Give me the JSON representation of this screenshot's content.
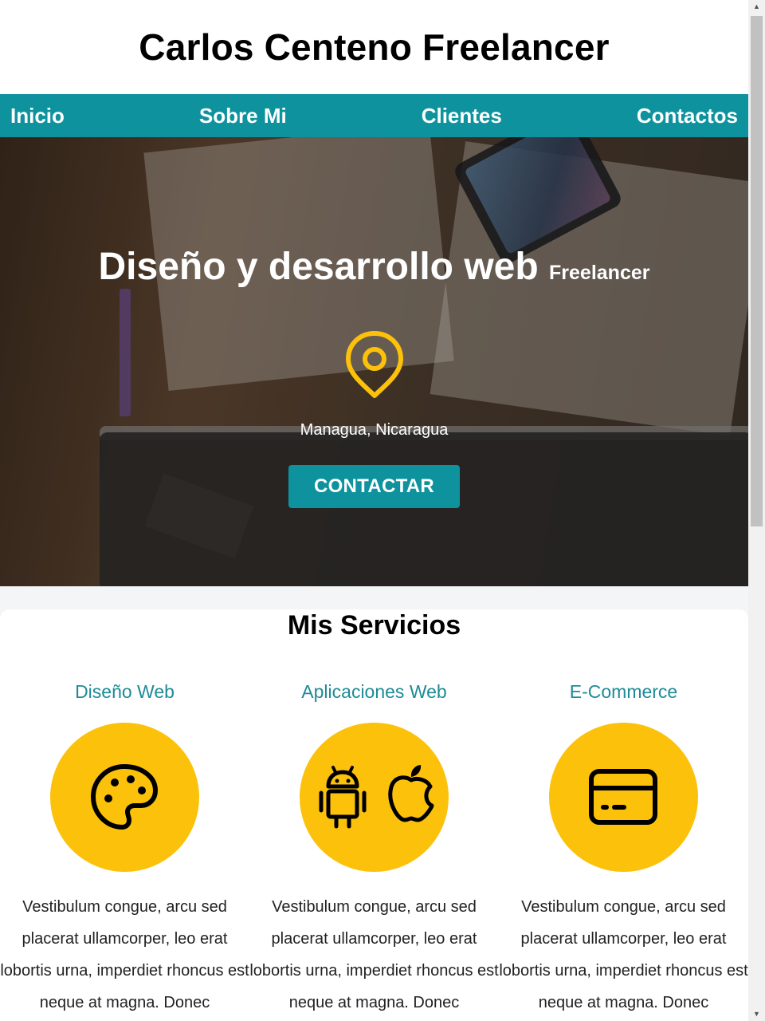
{
  "header": {
    "title": "Carlos Centeno Freelancer"
  },
  "nav": {
    "items": [
      "Inicio",
      "Sobre Mi",
      "Clientes",
      "Contactos"
    ]
  },
  "hero": {
    "title": "Diseño y desarrollo web",
    "title_small": "Freelancer",
    "pin_icon": "location-pin-icon",
    "location": "Managua, Nicaragua",
    "cta_label": "CONTACTAR"
  },
  "services": {
    "heading": "Mis Servicios",
    "cards": [
      {
        "title": "Diseño Web",
        "icon": "palette-icon",
        "text": "Vestibulum congue, arcu sed placerat ullamcorper, leo erat lobortis urna, imperdiet rhoncus est neque at magna. Donec"
      },
      {
        "title": "Aplicaciones Web",
        "icon": "android-apple-icon",
        "text": "Vestibulum congue, arcu sed placerat ullamcorper, leo erat lobortis urna, imperdiet rhoncus est neque at magna. Donec"
      },
      {
        "title": "E-Commerce",
        "icon": "credit-card-icon",
        "text": "Vestibulum congue, arcu sed placerat ullamcorper, leo erat lobortis urna, imperdiet rhoncus est neque at magna. Donec"
      }
    ]
  },
  "colors": {
    "accent": "#0e939e",
    "highlight": "#fcc10a",
    "service_title": "#1e8b97"
  }
}
